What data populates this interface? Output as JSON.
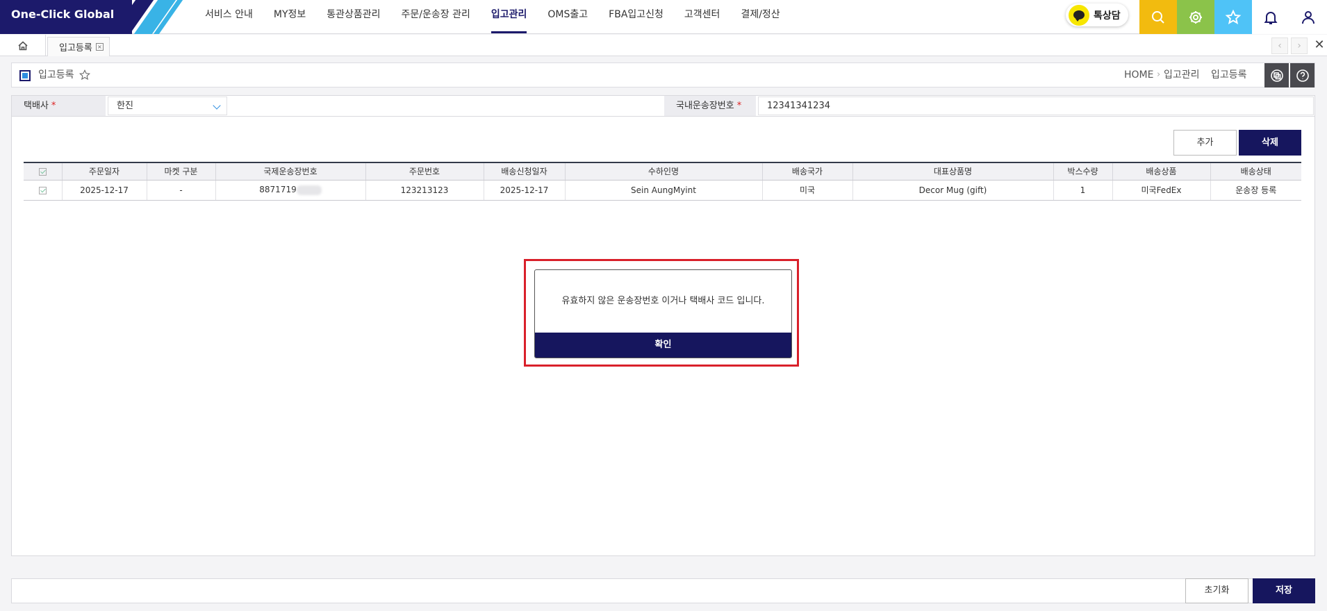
{
  "app": {
    "logo": "One-Click Global"
  },
  "nav": {
    "items": [
      {
        "label": "서비스 안내"
      },
      {
        "label": "MY정보"
      },
      {
        "label": "통관상품관리"
      },
      {
        "label": "주문/운송장 관리"
      },
      {
        "label": "입고관리"
      },
      {
        "label": "OMS출고"
      },
      {
        "label": "FBA입고신청"
      },
      {
        "label": "고객센터"
      },
      {
        "label": "결제/정산"
      }
    ],
    "active": "입고관리"
  },
  "quick": {
    "talk_label": "톡상담",
    "buttons": [
      {
        "icon": "search-icon",
        "color": "#F2BB0F"
      },
      {
        "icon": "settings-icon",
        "color": "#8BC34A"
      },
      {
        "icon": "star-icon",
        "color": "#4FC3F7"
      },
      {
        "icon": "bell-icon",
        "color": "#FFFFFF"
      },
      {
        "icon": "user-icon",
        "color": "#FFFFFF"
      }
    ]
  },
  "tabs": {
    "current": "입고등록",
    "close_glyph": "×"
  },
  "page": {
    "title": "입고등록",
    "breadcrumb": [
      "HOME",
      "입고관리",
      "입고등록"
    ]
  },
  "search": {
    "carrier_label": "택배사",
    "carrier_value": "한진",
    "tracking_label": "국내운송장번호",
    "tracking_value": "12341341234",
    "required_mark": "*"
  },
  "actions": {
    "add": "추가",
    "delete": "삭제"
  },
  "table": {
    "columns": [
      "주문일자",
      "마켓 구분",
      "국제운송장번호",
      "주문번호",
      "배송신청일자",
      "수하인명",
      "배송국가",
      "대표상품명",
      "박스수량",
      "배송상품",
      "배송상태"
    ],
    "rows": [
      {
        "order_date": "2025-12-17",
        "market": "-",
        "intl_tracking": "8871719",
        "order_no": "123213123",
        "request_date": "2025-12-17",
        "recipient": "Sein AungMyint",
        "country": "미국",
        "product": "Decor Mug (gift)",
        "boxes": "1",
        "service": "미국FedEx",
        "status": "운송장 등록"
      }
    ]
  },
  "alert": {
    "message": "유효하지 않은 운송장번호 이거나 택배사 코드 입니다.",
    "ok": "확인"
  },
  "footer": {
    "reset": "초기화",
    "save": "저장"
  },
  "colors": {
    "brand": "#1C1A6B",
    "accent": "#39B3E6",
    "highlight": "#D9202A"
  }
}
